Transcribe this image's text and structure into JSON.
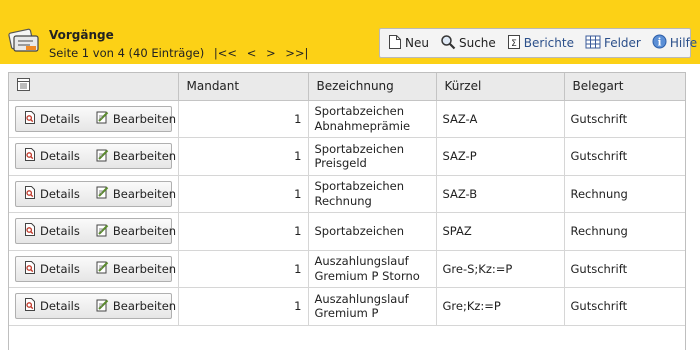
{
  "header": {
    "title": "Vorgänge",
    "page_info": "Seite 1 von 4 (40 Einträge)",
    "nav_first": "|<<",
    "nav_prev": "<",
    "nav_next": ">",
    "nav_last": ">>|"
  },
  "toolbar": {
    "new_label": "Neu",
    "search_label": "Suche",
    "reports_label": "Berichte",
    "fields_label": "Felder",
    "help_label": "Hilfe"
  },
  "table": {
    "columns": [
      "",
      "Mandant",
      "Bezeichnung",
      "Kürzel",
      "Belegart"
    ],
    "details_label": "Details",
    "edit_label": "Bearbeiten",
    "rows": [
      {
        "mandant": "1",
        "bezeichnung": "Sportabzeichen Abnahmeprämie",
        "kuerzel": "SAZ-A",
        "belegart": "Gutschrift"
      },
      {
        "mandant": "1",
        "bezeichnung": "Sportabzeichen Preisgeld",
        "kuerzel": "SAZ-P",
        "belegart": "Gutschrift"
      },
      {
        "mandant": "1",
        "bezeichnung": "Sportabzeichen Rechnung",
        "kuerzel": "SAZ-B",
        "belegart": "Rechnung"
      },
      {
        "mandant": "1",
        "bezeichnung": "Sportabzeichen",
        "kuerzel": "SPAZ",
        "belegart": "Rechnung"
      },
      {
        "mandant": "1",
        "bezeichnung": "Auszahlungslauf Gremium P Storno",
        "kuerzel": "Gre-S;Kz:=P",
        "belegart": "Gutschrift"
      },
      {
        "mandant": "1",
        "bezeichnung": "Auszahlungslauf Gremium P",
        "kuerzel": "Gre;Kz:=P",
        "belegart": "Gutschrift"
      }
    ]
  },
  "colors": {
    "header_bg": "#fcd116",
    "link": "#2b4f8a",
    "table_header_bg": "#eaeaea"
  },
  "icons": [
    "folder-card-icon",
    "new-document-icon",
    "magnifier-icon",
    "report-icon",
    "fields-grid-icon",
    "help-icon",
    "column-chooser-icon",
    "details-icon",
    "edit-icon"
  ]
}
